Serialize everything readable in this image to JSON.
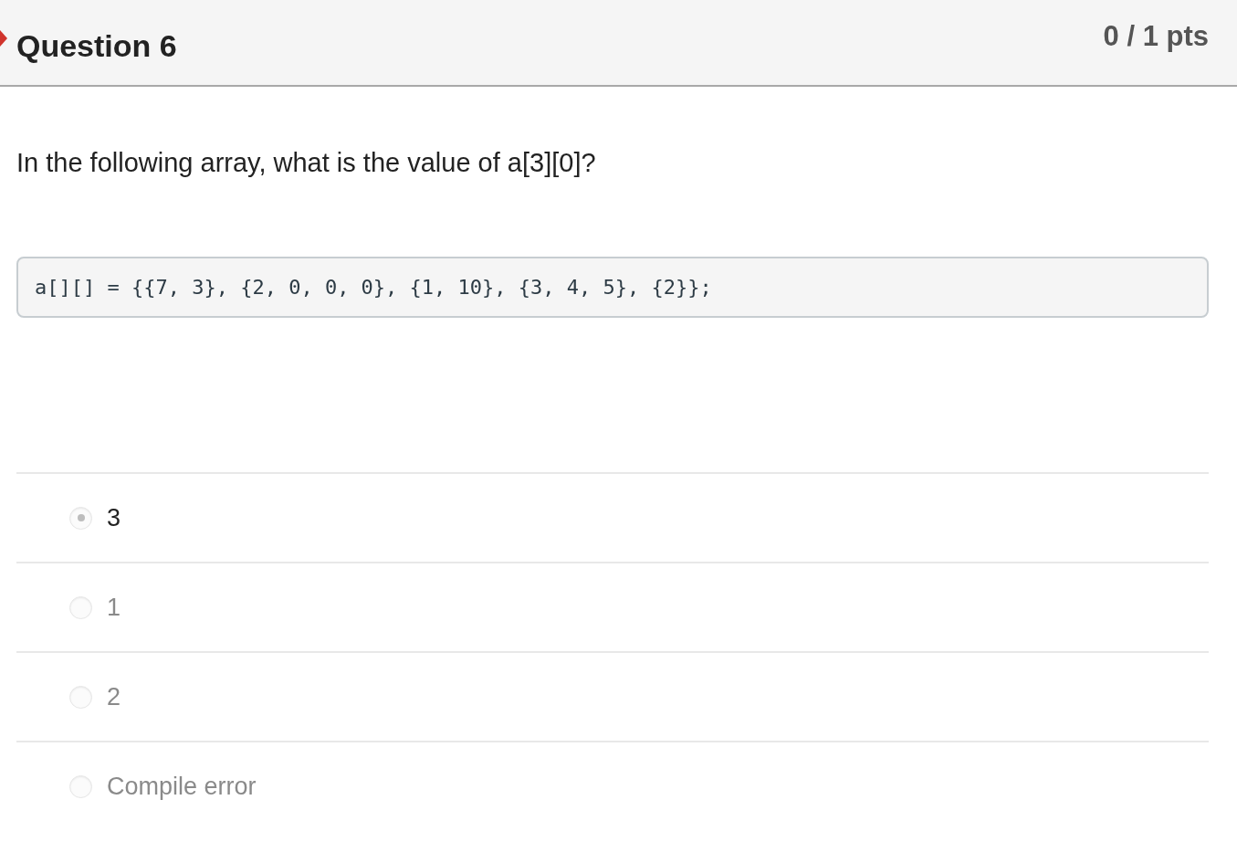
{
  "question": {
    "title": "Question 6",
    "points": "0 / 1 pts",
    "incorrect": true
  },
  "prompt": "In the following array, what is the value of a[3][0]?",
  "code": "a[][] = {{7, 3}, {2, 0, 0, 0}, {1, 10}, {3, 4, 5}, {2}};",
  "answers": [
    {
      "label": "3",
      "selected": true
    },
    {
      "label": "1",
      "selected": false
    },
    {
      "label": "2",
      "selected": false
    },
    {
      "label": "Compile error",
      "selected": false
    }
  ]
}
